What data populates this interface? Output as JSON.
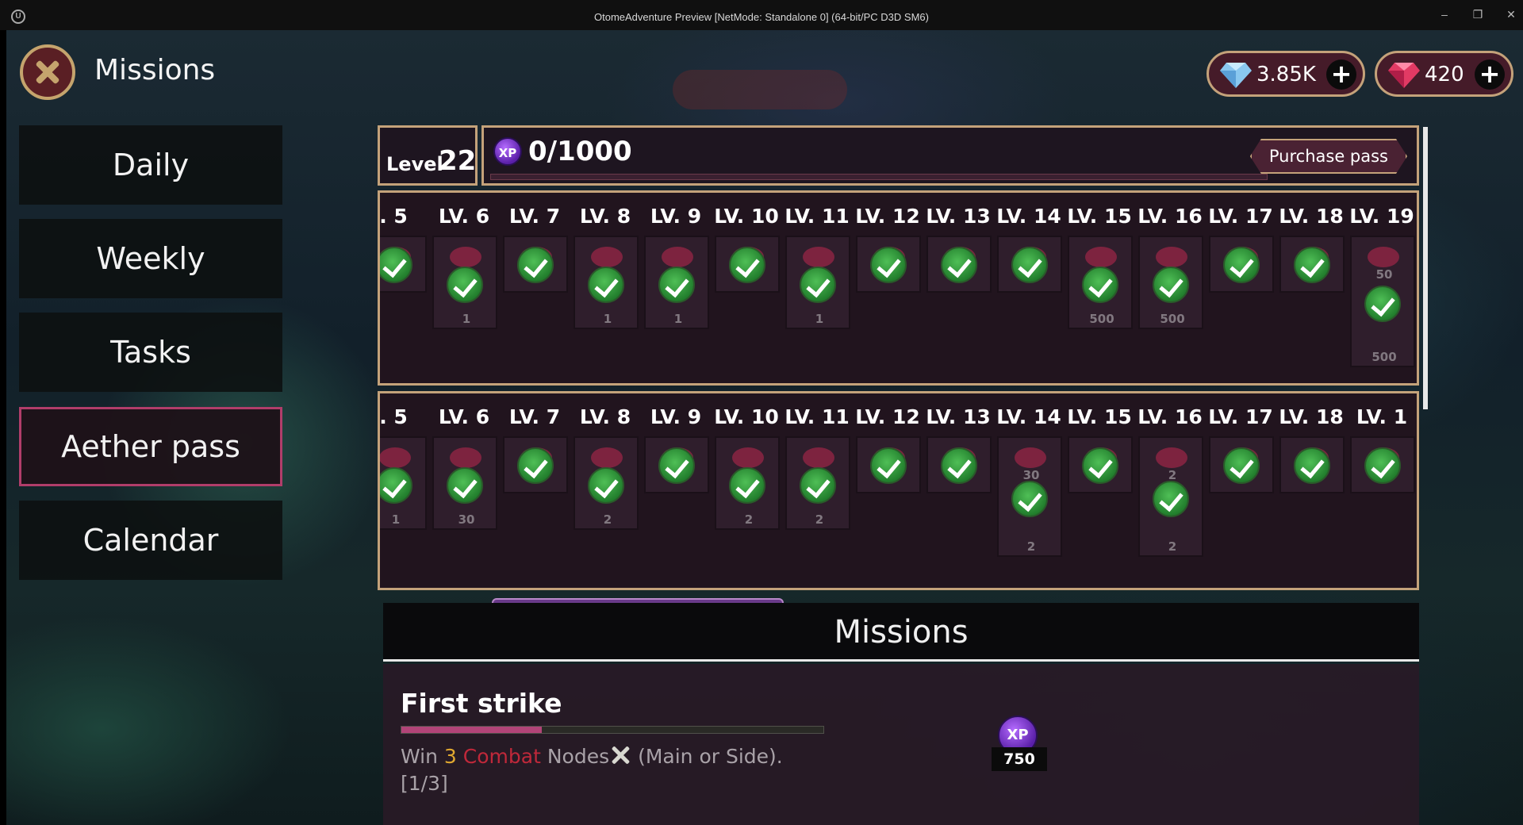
{
  "window": {
    "title": "OtomeAdventure Preview [NetMode: Standalone 0]  (64-bit/PC D3D SM6)",
    "minimize": "–",
    "restore": "❐",
    "close": "✕"
  },
  "header": {
    "title": "Missions",
    "gems": "3.85K",
    "rubies": "420",
    "plus": "+"
  },
  "sidebar": {
    "items": [
      {
        "label": "Daily"
      },
      {
        "label": "Weekly"
      },
      {
        "label": "Tasks"
      },
      {
        "label": "Aether pass"
      },
      {
        "label": "Calendar"
      }
    ],
    "active": "Aether pass"
  },
  "pass": {
    "level_label": "Level",
    "level": "22",
    "xp_icon": "XP",
    "xp_value": "0/1000",
    "xp_progress": 0,
    "purchase": "Purchase pass"
  },
  "tracks": {
    "premium": {
      "labels": [
        ". 5",
        "LV. 6",
        "LV. 7",
        "LV. 8",
        "LV. 9",
        "LV. 10",
        "LV. 11",
        "LV. 12",
        "LV. 13",
        "LV. 14",
        "LV. 15",
        "LV. 16",
        "LV. 17",
        "LV. 18",
        "LV. 19"
      ],
      "slot_quantities": [
        "",
        "1",
        "",
        "1",
        "1",
        "",
        "1",
        "",
        "",
        "",
        "500",
        "500",
        "",
        "",
        "500"
      ],
      "top_quantities": [
        "",
        "",
        "",
        "",
        "",
        "",
        "",
        "",
        "",
        "",
        "",
        "",
        "",
        "",
        "50"
      ]
    },
    "free": {
      "labels": [
        ". 5",
        "LV. 6",
        "LV. 7",
        "LV. 8",
        "LV. 9",
        "LV. 10",
        "LV. 11",
        "LV. 12",
        "LV. 13",
        "LV. 14",
        "LV. 15",
        "LV. 16",
        "LV. 17",
        "LV. 18",
        "LV. 1"
      ],
      "slot_quantities": [
        "1",
        "30",
        "",
        "2",
        "",
        "2",
        "2",
        "",
        "",
        "2",
        "",
        "2",
        "",
        "",
        ""
      ],
      "top_quantities": [
        "",
        "",
        "",
        "",
        "",
        "",
        "",
        "",
        "",
        "30",
        "",
        "2",
        "",
        "",
        ""
      ]
    }
  },
  "missions": {
    "heading": "Missions",
    "items": [
      {
        "title": "First strike",
        "progress": 0.333,
        "desc_win": "Win",
        "desc_count": "3",
        "desc_type": "Combat",
        "desc_rest": "Nodes",
        "desc_tail": "(Main or Side).",
        "counter": "[1/3]",
        "reward_icon": "XP",
        "reward_amount": "750"
      }
    ]
  },
  "colors": {
    "accent": "#c4a27a",
    "active_border": "#b13d6a",
    "combat": "#c0283a",
    "count": "#e0a830"
  },
  "icons": {
    "close": "close-icon",
    "gem": "diamond-icon",
    "ruby": "ruby-icon",
    "check": "checkmark-icon",
    "xp": "xp-orb-icon",
    "swords": "crossed-swords-icon"
  }
}
